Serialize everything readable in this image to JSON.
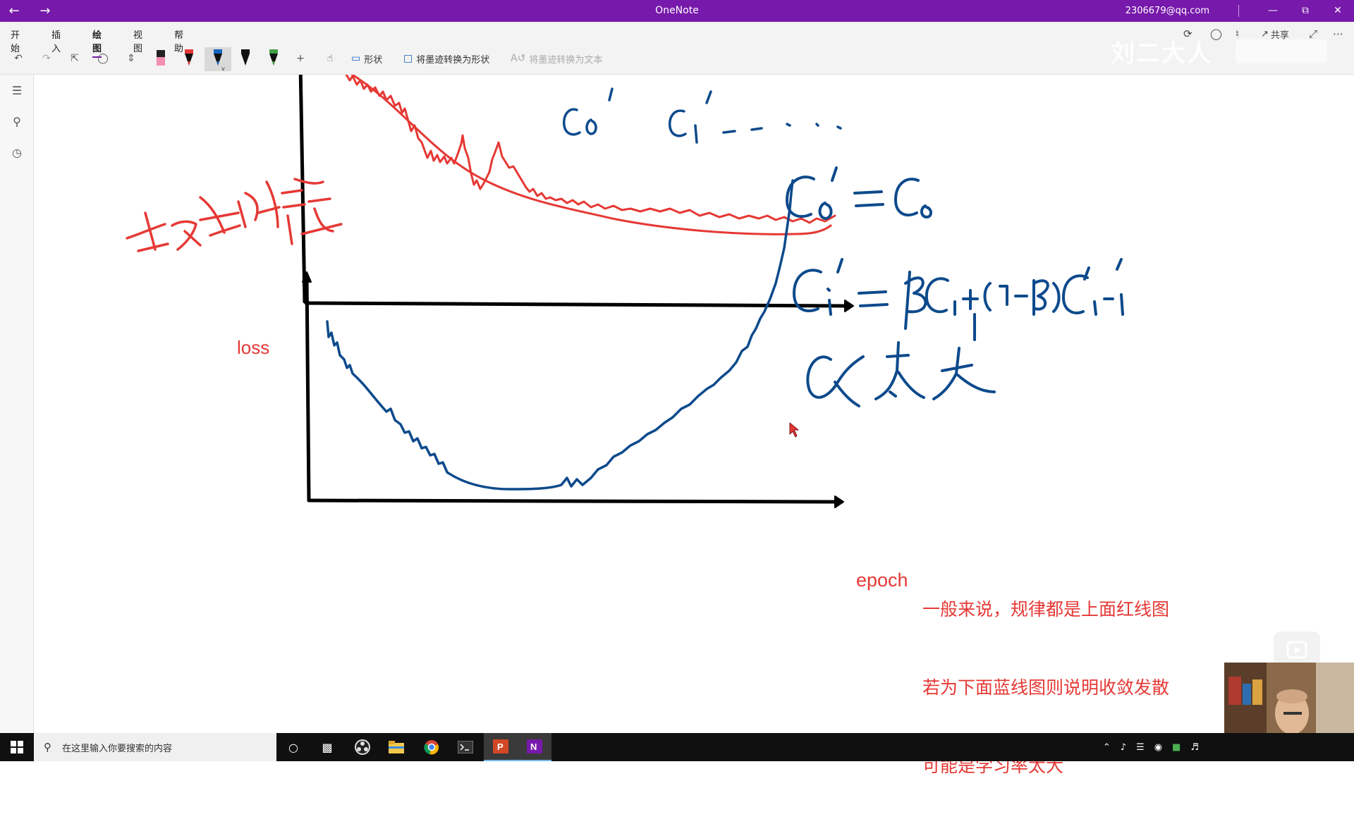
{
  "window": {
    "title": "OneNote",
    "account": "2306679@qq.com",
    "back_icon": "back-arrow-icon",
    "forward_icon": "forward-arrow-icon",
    "accent_color": "#7719aa"
  },
  "ribbon": {
    "tabs": [
      {
        "label": "开始",
        "active": false
      },
      {
        "label": "插入",
        "active": false
      },
      {
        "label": "绘图",
        "active": true
      },
      {
        "label": "视图",
        "active": false
      },
      {
        "label": "帮助",
        "active": false
      }
    ],
    "shapes_label": "形状",
    "ink_to_shape_label": "将墨迹转换为形状",
    "ink_to_text_label": "将墨迹转换为文本",
    "share_label": "共享",
    "pens": [
      {
        "name": "highlighter-pink",
        "color": "#f48fb1"
      },
      {
        "name": "pen-red",
        "color": "#e53935"
      },
      {
        "name": "pen-blue",
        "color": "#1565c0",
        "selected": true
      },
      {
        "name": "pen-black",
        "color": "#111111"
      },
      {
        "name": "pen-green",
        "color": "#43a047"
      }
    ],
    "watermark": "刘二大人"
  },
  "canvas": {
    "ink_colors": {
      "red": "#e53935",
      "blue": "#0d4a8c",
      "black": "#000000"
    },
    "loss_label": "loss",
    "epoch_label": "epoch",
    "note_lines": [
      "一般来说，规律都是上面红线图",
      "若为下面蓝线图则说明收敛发散",
      "可能是学习率太大"
    ]
  },
  "taskbar": {
    "search_placeholder": "在这里输入你要搜索的内容",
    "apps": [
      "cortana-icon",
      "task-view-icon",
      "obs-icon",
      "file-explorer-icon",
      "chrome-icon",
      "terminal-icon",
      "powerpoint-icon",
      "onenote-icon"
    ]
  }
}
